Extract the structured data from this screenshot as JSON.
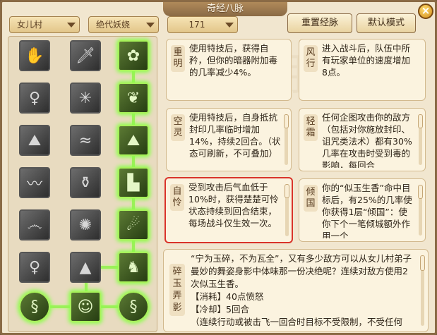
{
  "window": {
    "title": "奇经八脉",
    "close_label": "×"
  },
  "filters": {
    "school": "女儿村",
    "skill": "绝代妖娆",
    "points": "171"
  },
  "buttons": {
    "reset": "重置经脉",
    "default": "默认模式"
  },
  "icons": [
    "handshake-icon",
    "dagger-icon",
    "flower-icon",
    "lady-icon",
    "spider-icon",
    "leaf-icon",
    "mountain-icon",
    "wave-icon",
    "landscape-icon",
    "ocean-wave-icon",
    "pot-icon",
    "cliff-icon",
    "swirl-wave-icon",
    "sun-icon",
    "dancer-icon",
    "lady-robe-icon",
    "rocks-icon",
    "crouch-figure-icon",
    "dragon-icon",
    "portrait-icon",
    "dragon-swirl-icon"
  ],
  "cards": [
    {
      "name": "重明",
      "text": "使用特技后，获得自矜，但你的暗器附加毒的几率减少4%。"
    },
    {
      "name": "风行",
      "text": "进入战斗后，队伍中所有玩家单位的速度增加8点。"
    },
    {
      "name": "空灵",
      "text": "使用特技后，自身抵抗封印几率临时增加14%，持续2回合。（状态可刷新，不可叠加）"
    },
    {
      "name": "轻霜",
      "text": "任何企图攻击你的敌方（包括对你施放封印、诅咒类法术）都有30%几率在攻击时受到毒的影响，每回合"
    },
    {
      "name": "自怜",
      "text": "受到攻击后气血低于10%时，获得楚楚可怜状态持续到回合结束，每场战斗仅生效一次。"
    },
    {
      "name": "倾国",
      "text": "你的“似玉生香”命中目标后，有25%的几率使你获得1层“倾国”：使你下个一笔倾城额外作用一个"
    }
  ],
  "detail": {
    "name": "碎玉弄影",
    "text": "“宁为玉碎，不为瓦全”，又有多少敌方可以从女儿村弟子曼妙的舞姿身影中体味那一份决绝呢？连续对敌方使用2次似玉生香。",
    "cost": "【消耗】40点愤怒",
    "cooldown": "【冷却】5回合",
    "extra": "（连续行动或被击飞一回合时目标不受限制，不受任何"
  },
  "colors": {
    "active_glow": "#8cff4a",
    "selected_border": "#d9332a"
  }
}
